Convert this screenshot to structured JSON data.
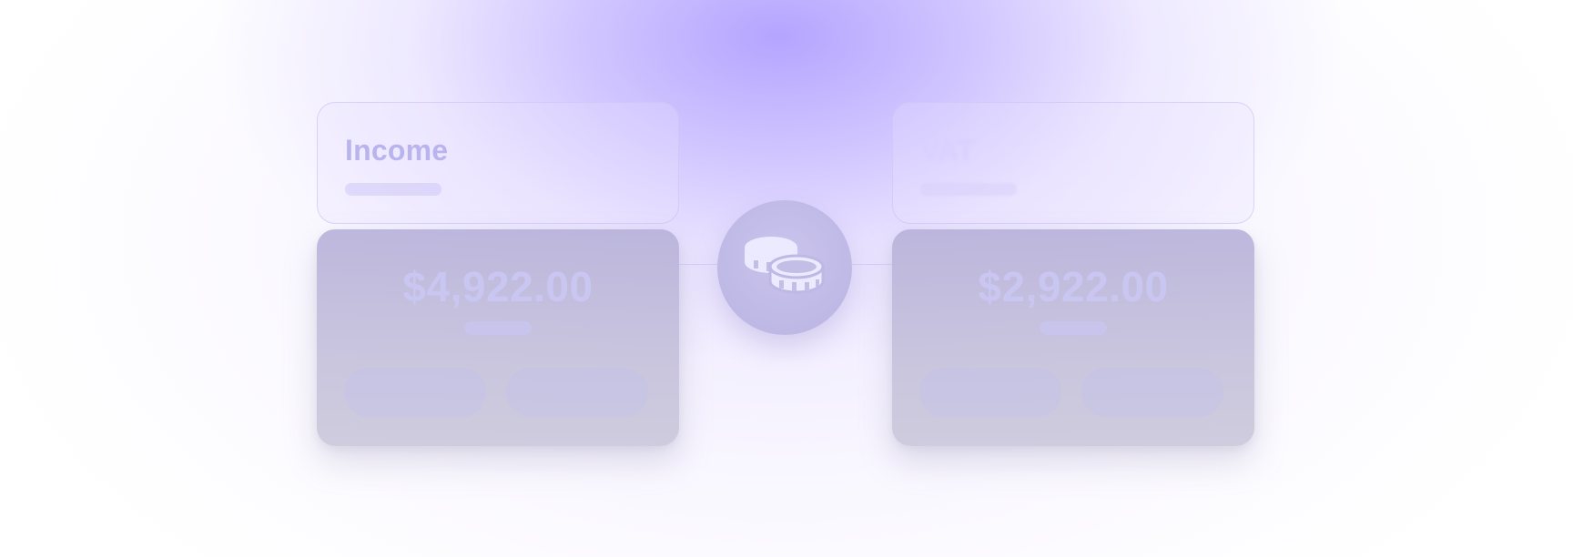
{
  "income": {
    "label": "Income",
    "amount": "$4,922.00"
  },
  "vat": {
    "label": "VAT",
    "amount": "$2,922.00"
  },
  "center": {
    "icon": "coins-icon"
  },
  "colors": {
    "accent": "#b9a8ff",
    "card": "#c3bfdc",
    "text": "#c9c6f2"
  }
}
